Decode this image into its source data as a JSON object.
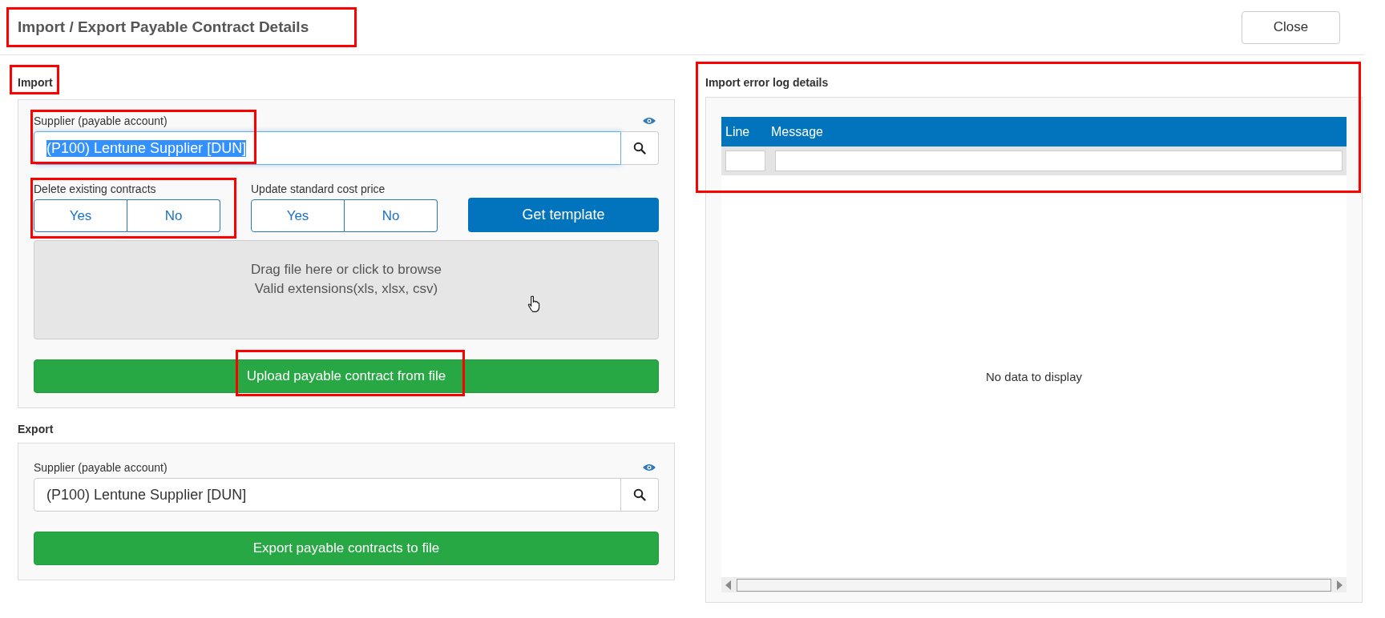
{
  "window": {
    "title": "Import / Export Payable Contract Details",
    "title_highlighted": true,
    "close_button": "Close"
  },
  "import": {
    "label": "Import",
    "label_highlighted": true,
    "supplier": {
      "label": "Supplier (payable account)",
      "value": "(P100) Lentune Supplier [DUN]",
      "text_selected": true,
      "highlighted": true
    },
    "toggles": [
      {
        "label": "Delete existing contracts",
        "highlighted": true,
        "options": [
          {
            "label": "Yes",
            "selected": false
          },
          {
            "label": "No",
            "selected": false
          }
        ]
      },
      {
        "label": "Update standard cost price",
        "highlighted": false,
        "options": [
          {
            "label": "Yes",
            "selected": false
          },
          {
            "label": "No",
            "selected": false
          }
        ]
      }
    ],
    "template_button": "Get template",
    "dropzone": {
      "line_1": "Drag file here or click to browse",
      "line_2": "Valid extensions(xls, xlsx, csv)"
    },
    "upload_button": {
      "label": "Upload payable contract from file",
      "highlighted": true
    }
  },
  "export": {
    "label": "Export",
    "supplier": {
      "label": "Supplier (payable account)",
      "value": "(P100) Lentune Supplier [DUN]",
      "text_selected": false
    },
    "export_button": "Export payable contracts to file"
  },
  "error_log": {
    "label": "Import error log details",
    "highlighted": true,
    "table": {
      "columns": [
        "Line",
        "Message"
      ]
    },
    "empty_text": "No data to display"
  }
}
